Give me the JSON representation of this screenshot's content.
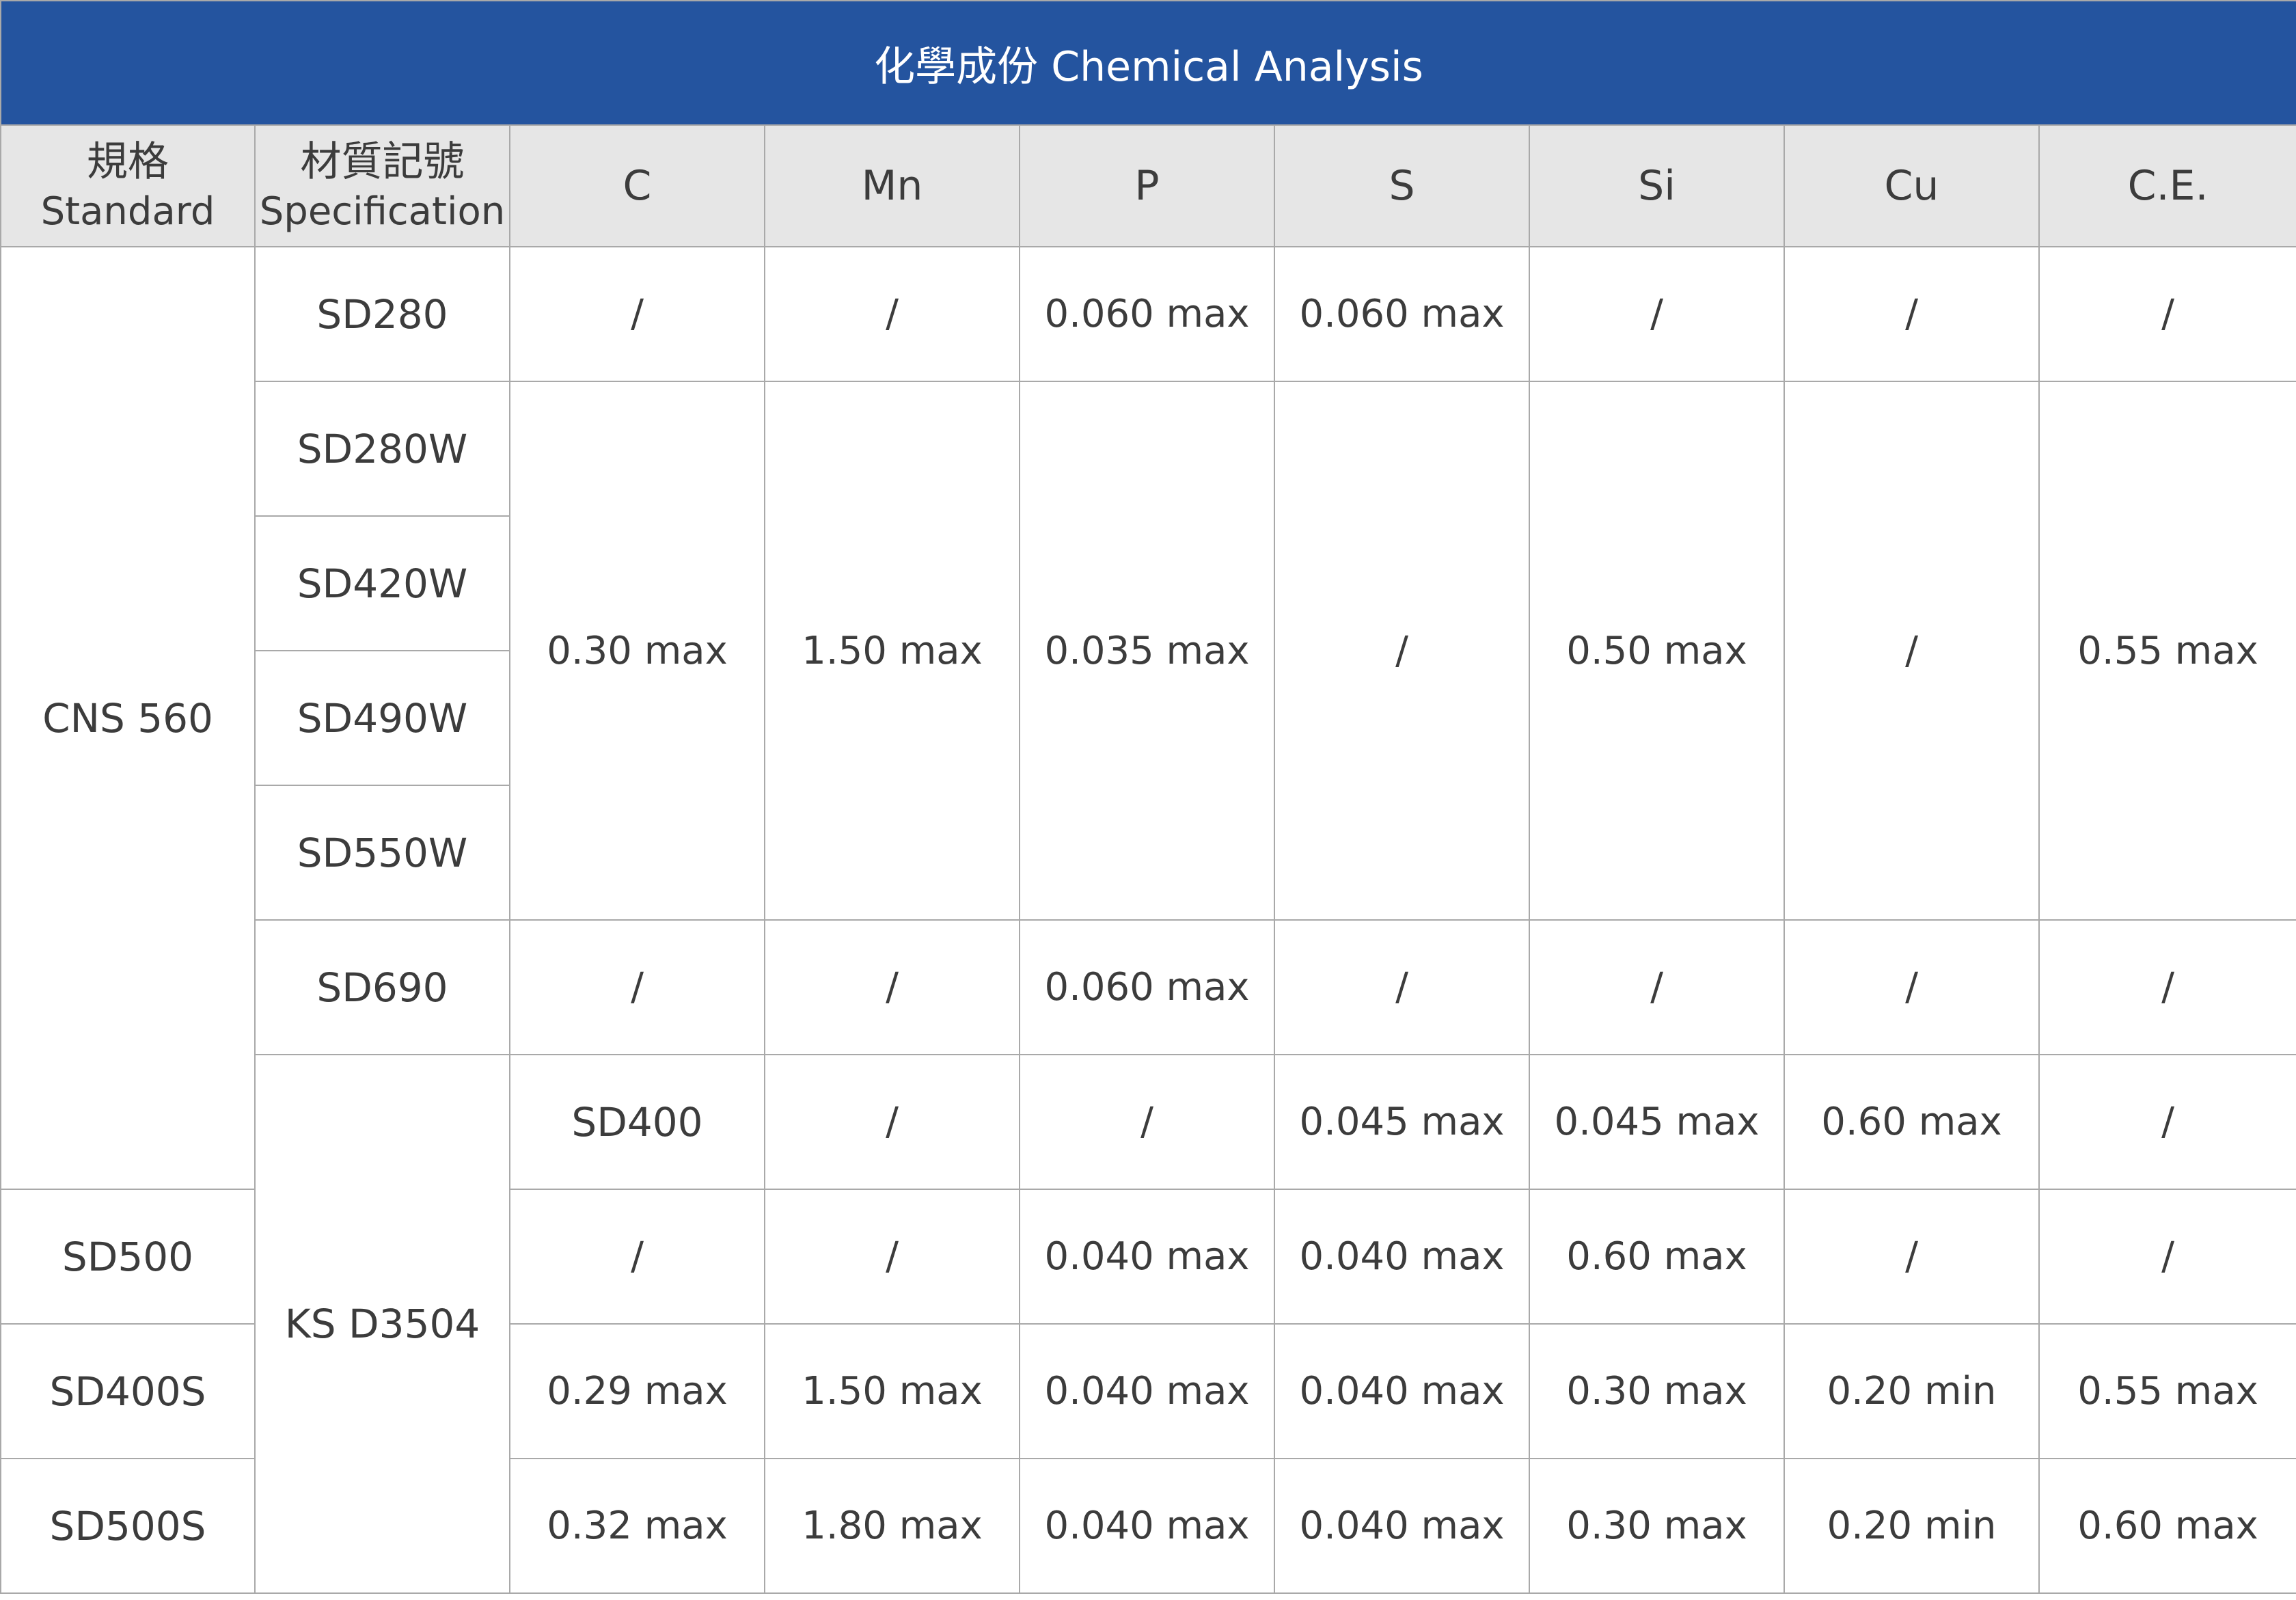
{
  "title": "化學成份 Chemical Analysis",
  "headers": {
    "standard_zh": "規格",
    "standard_en": "Standard",
    "spec_zh": "材質記號",
    "spec_en": "Specification",
    "elements": [
      "C",
      "Mn",
      "P",
      "S",
      "Si",
      "Cu",
      "C.E."
    ]
  },
  "standards": {
    "cns": "CNS 560",
    "ks": "KS D3504"
  },
  "specs": [
    "SD280",
    "SD280W",
    "SD420W",
    "SD490W",
    "SD550W",
    "SD690",
    "SD400",
    "SD500",
    "SD400S",
    "SD500S"
  ],
  "rows": {
    "sd280": [
      "/",
      "/",
      "0.060 max",
      "0.060 max",
      "/",
      "/",
      "/"
    ],
    "cns_w_group": [
      "0.30 max",
      "1.50 max",
      "0.035 max",
      "/",
      "0.50 max",
      "/",
      "0.55 max"
    ],
    "sd690": [
      "/",
      "/",
      "0.060 max",
      "/",
      "/",
      "/",
      "/"
    ],
    "sd400": [
      "/",
      "/",
      "0.045 max",
      "0.045 max",
      "0.60 max",
      "/",
      "/"
    ],
    "sd500": [
      "/",
      "/",
      "0.040 max",
      "0.040 max",
      "0.60 max",
      "/",
      "/"
    ],
    "sd400s": [
      "0.29 max",
      "1.50 max",
      "0.040 max",
      "0.040 max",
      "0.30 max",
      "0.20 min",
      "0.55 max"
    ],
    "sd500s": [
      "0.32 max",
      "1.80 max",
      "0.040 max",
      "0.040 max",
      "0.30 max",
      "0.20 min",
      "0.60 max"
    ]
  },
  "colors": {
    "title_bg": "#24549f",
    "header_bg": "#e6e6e6",
    "border": "#a9a9a9",
    "text": "#3c3c3c"
  }
}
